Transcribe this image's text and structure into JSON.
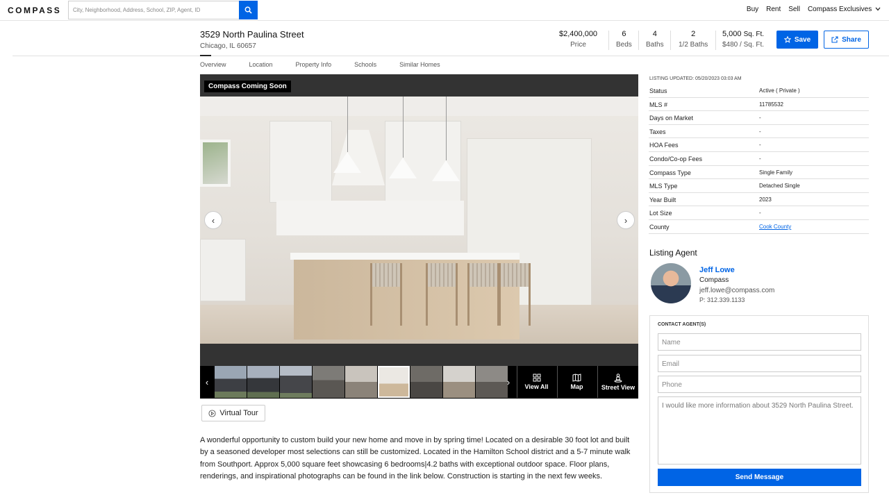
{
  "nav": {
    "logo": "COMPASS",
    "search_placeholder": "City, Neighborhood, Address, School, ZIP, Agent, ID",
    "links": [
      "Buy",
      "Rent",
      "Sell",
      "Compass Exclusives"
    ]
  },
  "listing": {
    "address": "3529 North Paulina Street",
    "city": "Chicago, IL 60657",
    "price": "$2,400,000",
    "price_label": "Price",
    "beds": "6",
    "beds_label": "Beds",
    "baths": "4",
    "baths_label": "Baths",
    "half_baths": "2",
    "half_baths_label": "1/2 Baths",
    "sqft_value": "5,000",
    "sqft_unit": "Sq. Ft.",
    "price_per_sqft": "$480 / Sq. Ft.",
    "save_label": "Save",
    "share_label": "Share"
  },
  "tabs": [
    "Overview",
    "Location",
    "Property Info",
    "Schools",
    "Similar Homes"
  ],
  "gallery": {
    "badge": "Compass Coming Soon",
    "actions": [
      "View All",
      "Map",
      "Street View"
    ],
    "virtual_tour": "Virtual Tour"
  },
  "description": "A wonderful opportunity to custom build your new home and move in by spring time! Located on a desirable 30 foot lot and built by a seasoned developer most selections can still be customized. Located in the Hamilton School district and a 5-7 minute walk from Southport. Approx 5,000 square feet showcasing 6 bedrooms|4.2 baths with exceptional outdoor space. Floor plans, renderings, and inspirational photographs can be found in the link below. Construction is starting in the next few weeks.",
  "facts": {
    "updated": "LISTING UPDATED: 05/20/2023 03:03 AM",
    "rows": [
      {
        "k": "Status",
        "v": "Active ( Private )"
      },
      {
        "k": "MLS #",
        "v": "11785532"
      },
      {
        "k": "Days on Market",
        "v": "-"
      },
      {
        "k": "Taxes",
        "v": "-"
      },
      {
        "k": "HOA Fees",
        "v": "-"
      },
      {
        "k": "Condo/Co-op Fees",
        "v": "-"
      },
      {
        "k": "Compass Type",
        "v": "Single Family"
      },
      {
        "k": "MLS Type",
        "v": "Detached Single"
      },
      {
        "k": "Year Built",
        "v": "2023"
      },
      {
        "k": "Lot Size",
        "v": "-"
      },
      {
        "k": "County",
        "v": "Cook County"
      }
    ]
  },
  "agent": {
    "heading": "Listing Agent",
    "name": "Jeff Lowe",
    "company": "Compass",
    "email": "jeff.lowe@compass.com",
    "phone": "P: 312.339.1133"
  },
  "contact": {
    "heading": "CONTACT AGENT(S)",
    "name_placeholder": "Name",
    "email_placeholder": "Email",
    "phone_placeholder": "Phone",
    "message": "I would like more information about 3529 North Paulina Street.",
    "send_label": "Send Message"
  },
  "colors": {
    "accent": "#0064e5"
  }
}
